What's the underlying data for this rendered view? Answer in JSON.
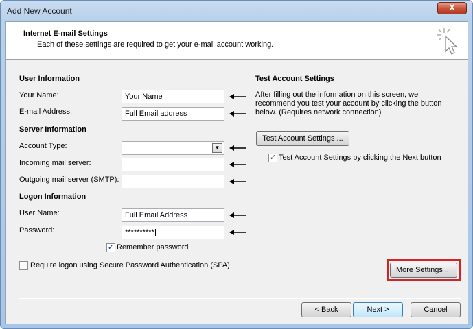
{
  "window": {
    "title": "Add New Account",
    "close_label": "X"
  },
  "header": {
    "title": "Internet E-mail Settings",
    "subtitle": "Each of these settings are required to get your e-mail account working."
  },
  "user_info": {
    "heading": "User Information",
    "your_name_label": "Your Name:",
    "your_name_value": "Your Name",
    "email_label": "E-mail Address:",
    "email_value": "Full Email address"
  },
  "server_info": {
    "heading": "Server Information",
    "account_type_label": "Account Type:",
    "account_type_value": "",
    "incoming_label": "Incoming mail server:",
    "incoming_value": "",
    "outgoing_label": "Outgoing mail server (SMTP):",
    "outgoing_value": ""
  },
  "logon_info": {
    "heading": "Logon Information",
    "username_label": "User Name:",
    "username_value": "Full Email Address",
    "password_label": "Password:",
    "password_value": "**********",
    "remember_label": "Remember password",
    "remember_checked": true,
    "spa_label": "Require logon using Secure Password Authentication (SPA)",
    "spa_checked": false
  },
  "test_settings": {
    "heading": "Test Account Settings",
    "description_lines": [
      "After filling out the information on this screen, we",
      "recommend you test your account by clicking the button",
      "below. (Requires network connection)"
    ],
    "test_button": "Test Account Settings ...",
    "auto_test_label": "Test Account Settings by clicking the Next button",
    "auto_test_checked": true
  },
  "buttons": {
    "more_settings": "More Settings ...",
    "back": "< Back",
    "next": "Next >",
    "cancel": "Cancel"
  },
  "colors": {
    "highlight": "#d2232a"
  }
}
